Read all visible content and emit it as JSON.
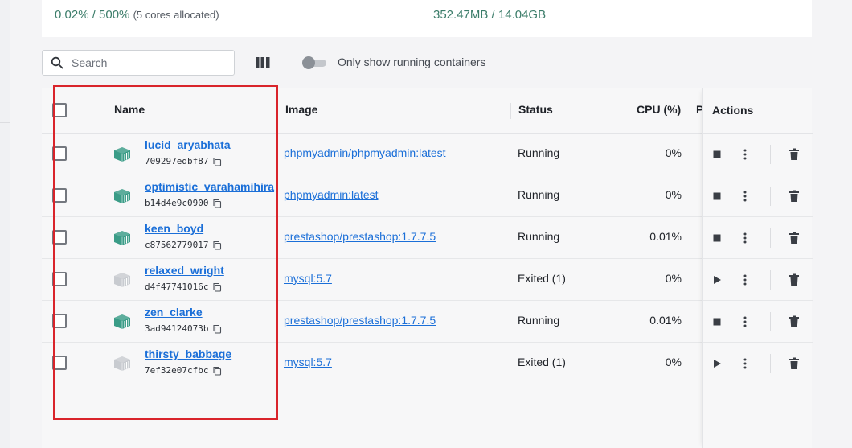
{
  "stats": {
    "cpu_value": "0.02% / 500%",
    "cpu_sub": "(5 cores allocated)",
    "mem_value": "352.47MB / 14.04GB"
  },
  "search": {
    "placeholder": "Search",
    "icon": "search-icon"
  },
  "toolbar": {
    "columns_icon": "columns-icon",
    "toggle_label": "Only show running containers",
    "toggle_on": false
  },
  "table": {
    "headers": {
      "name": "Name",
      "image": "Image",
      "status": "Status",
      "cpu": "CPU (%)",
      "ports_truncated": "P",
      "actions": "Actions"
    },
    "rows": [
      {
        "name": "lucid_aryabhata",
        "id": "709297edbf87",
        "image": "phpmyadmin/phpmyadmin:latest",
        "status": "Running",
        "cpu": "0%",
        "running": true
      },
      {
        "name": "optimistic_varahamihira",
        "id": "b14d4e9c0900",
        "image": "phpmyadmin:latest",
        "status": "Running",
        "cpu": "0%",
        "running": true
      },
      {
        "name": "keen_boyd",
        "id": "c87562779017",
        "image": "prestashop/prestashop:1.7.7.5",
        "status": "Running",
        "cpu": "0.01%",
        "running": true
      },
      {
        "name": "relaxed_wright",
        "id": "d4f47741016c",
        "image": "mysql:5.7",
        "status": "Exited (1)",
        "cpu": "0%",
        "running": false
      },
      {
        "name": "zen_clarke",
        "id": "3ad94124073b",
        "image": "prestashop/prestashop:1.7.7.5",
        "status": "Running",
        "cpu": "0.01%",
        "running": true
      },
      {
        "name": "thirsty_babbage",
        "id": "7ef32e07cfbc",
        "image": "mysql:5.7",
        "status": "Exited (1)",
        "cpu": "0%",
        "running": false
      }
    ]
  },
  "colors": {
    "running_icon": "#3a9c87",
    "stopped_icon": "#c8cbd0",
    "link": "#1b6fd8",
    "highlight": "#d9242b"
  }
}
